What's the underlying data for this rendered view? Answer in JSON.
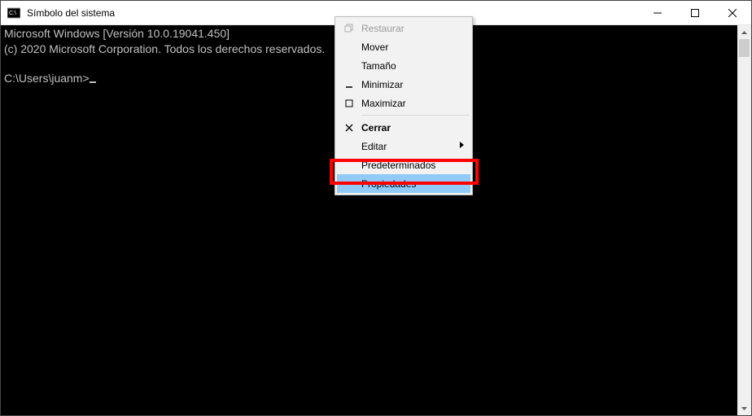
{
  "titlebar": {
    "title": "Símbolo del sistema"
  },
  "console": {
    "line1": "Microsoft Windows [Versión 10.0.19041.450]",
    "line2": "(c) 2020 Microsoft Corporation. Todos los derechos reservados.",
    "prompt": "C:\\Users\\juanm>"
  },
  "menu": {
    "restore": "Restaurar",
    "move": "Mover",
    "size": "Tamaño",
    "minimize": "Minimizar",
    "maximize": "Maximizar",
    "close": "Cerrar",
    "edit": "Editar",
    "defaults": "Predeterminados",
    "properties": "Propiedades"
  }
}
